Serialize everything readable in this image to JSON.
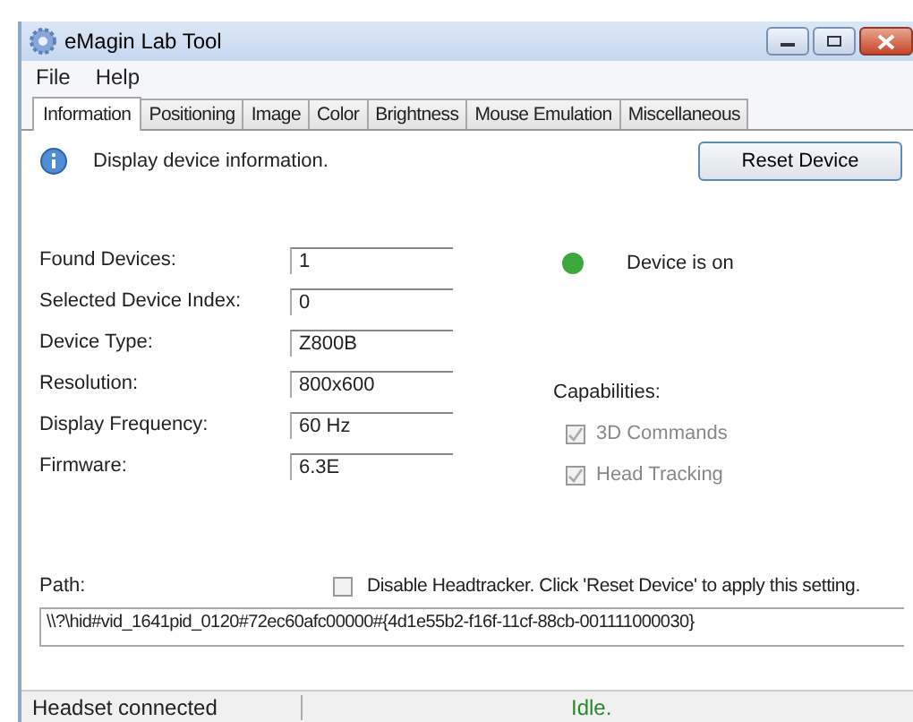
{
  "window": {
    "title": "eMagin Lab Tool"
  },
  "menu": [
    "File",
    "Help"
  ],
  "tabs": [
    {
      "label": "Information",
      "selected": true
    },
    {
      "label": "Positioning",
      "selected": false
    },
    {
      "label": "Image",
      "selected": false
    },
    {
      "label": "Color",
      "selected": false
    },
    {
      "label": "Brightness",
      "selected": false
    },
    {
      "label": "Mouse Emulation",
      "selected": false
    },
    {
      "label": "Miscellaneous",
      "selected": false
    }
  ],
  "info_text": "Display device information.",
  "reset_button": "Reset Device",
  "fields": [
    {
      "label": "Found Devices:",
      "value": "1"
    },
    {
      "label": "Selected Device Index:",
      "value": "0"
    },
    {
      "label": "Device Type:",
      "value": "Z800B"
    },
    {
      "label": "Resolution:",
      "value": "800x600"
    },
    {
      "label": "Display Frequency:",
      "value": "60 Hz"
    },
    {
      "label": "Firmware:",
      "value": "6.3E"
    }
  ],
  "device_status": {
    "text": "Device is on",
    "color": "#3aa83a"
  },
  "capabilities": {
    "label": "Capabilities:",
    "items": [
      {
        "label": "3D Commands",
        "checked": true,
        "disabled": true
      },
      {
        "label": "Head Tracking",
        "checked": true,
        "disabled": true
      }
    ]
  },
  "path": {
    "label": "Path:",
    "value": "\\\\?\\hid#vid_1641pid_0120#72ec60afc00000#{4d1e55b2-f16f-11cf-88cb-001111000030}"
  },
  "disable_headtracker": {
    "label": "Disable Headtracker. Click 'Reset Device' to apply this setting.",
    "checked": false
  },
  "status_bar": {
    "left": "Headset connected",
    "right": "Idle."
  }
}
